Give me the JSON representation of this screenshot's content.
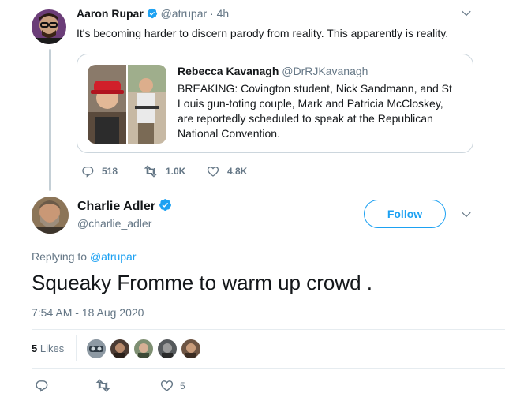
{
  "parent_tweet": {
    "author_name": "Aaron Rupar",
    "author_handle": "@atrupar",
    "time": "· 4h",
    "text": "It's becoming harder to discern parody from reality. This apparently is reality.",
    "quoted": {
      "author_name": "Rebecca Kavanagh",
      "author_handle": "@DrRJKavanagh",
      "text": "BREAKING: Covington student, Nick Sandmann, and St Louis gun-toting couple, Mark and Patricia McCloskey, are reportedly scheduled to speak at the Republican National Convention."
    },
    "actions": {
      "replies": "518",
      "retweets": "1.0K",
      "likes": "4.8K"
    }
  },
  "main_tweet": {
    "author_name": "Charlie Adler",
    "author_handle": "@charlie_adler",
    "follow_label": "Follow",
    "replying_prefix": "Replying to",
    "replying_to": "@atrupar",
    "text": "Squeaky Fromme to warm up crowd .",
    "timestamp": "7:54 AM - 18 Aug 2020",
    "likes_count": "5",
    "likes_label": "Likes",
    "actions": {
      "likes": "5"
    }
  },
  "colors": {
    "accent": "#1da1f2",
    "muted": "#657786",
    "border": "#e6ecf0"
  },
  "icons": [
    "chevron-down-icon",
    "verified-badge-icon",
    "reply-icon",
    "retweet-icon",
    "like-icon"
  ]
}
